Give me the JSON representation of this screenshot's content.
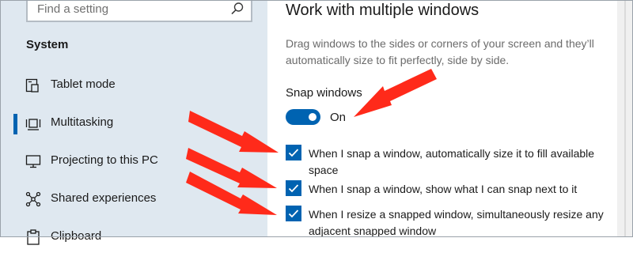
{
  "sidebar": {
    "search": {
      "placeholder": "Find a setting",
      "icon": "search-icon"
    },
    "section_title": "System",
    "items": [
      {
        "label": "Tablet mode",
        "icon": "tablet-mode-icon",
        "selected": false
      },
      {
        "label": "Multitasking",
        "icon": "multitasking-icon",
        "selected": true
      },
      {
        "label": "Projecting to this PC",
        "icon": "projecting-icon",
        "selected": false
      },
      {
        "label": "Shared experiences",
        "icon": "shared-experiences-icon",
        "selected": false
      },
      {
        "label": "Clipboard",
        "icon": "clipboard-icon",
        "selected": false
      }
    ]
  },
  "main": {
    "heading": "Work with multiple windows",
    "description": "Drag windows to the sides or corners of your screen and they’ll automatically size to fit perfectly, side by side.",
    "snap_windows": {
      "label": "Snap windows",
      "state": "On",
      "on": true
    },
    "options": [
      {
        "label": "When I snap a window, automatically size it to fill available space",
        "checked": true
      },
      {
        "label": "When I snap a window, show what I can snap next to it",
        "checked": true
      },
      {
        "label": "When I resize a snapped window, simultaneously resize any adjacent snapped window",
        "checked": true
      }
    ]
  },
  "colors": {
    "accent": "#0063b1",
    "sidebar_bg": "#dfe8f0",
    "annotation_arrow": "#ff2a1a"
  }
}
